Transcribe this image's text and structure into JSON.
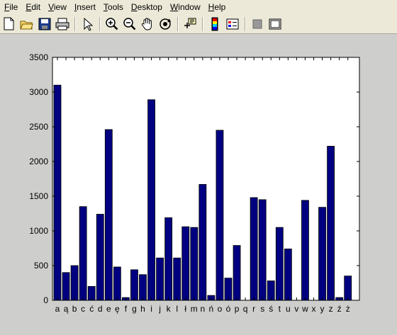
{
  "menu": {
    "items": [
      {
        "underline": "F",
        "rest": "ile"
      },
      {
        "underline": "E",
        "rest": "dit"
      },
      {
        "underline": "V",
        "rest": "iew"
      },
      {
        "underline": "I",
        "rest": "nsert"
      },
      {
        "underline": "T",
        "rest": "ools"
      },
      {
        "underline": "D",
        "rest": "esktop"
      },
      {
        "underline": "W",
        "rest": "indow"
      },
      {
        "underline": "H",
        "rest": "elp"
      }
    ]
  },
  "toolbar": {
    "icons": [
      "new-figure-icon",
      "open-file-icon",
      "save-icon",
      "print-icon",
      "|",
      "select-arrow-icon",
      "|",
      "zoom-in-icon",
      "zoom-out-icon",
      "pan-hand-icon",
      "rotate-3d-icon",
      "|",
      "data-cursor-icon",
      "|",
      "colorbar-icon",
      "legend-icon",
      "|",
      "hide-plot-tools-icon",
      "show-plot-tools-icon"
    ]
  },
  "colors": {
    "bar_fill": "#000080",
    "bar_edge": "#000000",
    "figure_bg": "#cecfcc",
    "axes_bg": "#ffffff"
  },
  "chart_data": {
    "type": "bar",
    "categories": [
      "a",
      "ą",
      "b",
      "c",
      "ć",
      "d",
      "e",
      "ę",
      "f",
      "g",
      "h",
      "i",
      "j",
      "k",
      "l",
      "ł",
      "m",
      "n",
      "ń",
      "o",
      "ó",
      "p",
      "q",
      "r",
      "s",
      "ś",
      "t",
      "u",
      "v",
      "w",
      "x",
      "y",
      "z",
      "ź",
      "ż"
    ],
    "values": [
      3100,
      400,
      500,
      1350,
      200,
      1240,
      2460,
      480,
      40,
      440,
      370,
      2890,
      610,
      1190,
      610,
      1060,
      1050,
      1670,
      70,
      2450,
      320,
      790,
      0,
      1480,
      1450,
      280,
      1050,
      740,
      0,
      1440,
      0,
      1340,
      2220,
      40,
      350
    ],
    "ylim": [
      0,
      3500
    ],
    "yticks": [
      0,
      500,
      1000,
      1500,
      2000,
      2500,
      3000,
      3500
    ],
    "grid": false
  }
}
